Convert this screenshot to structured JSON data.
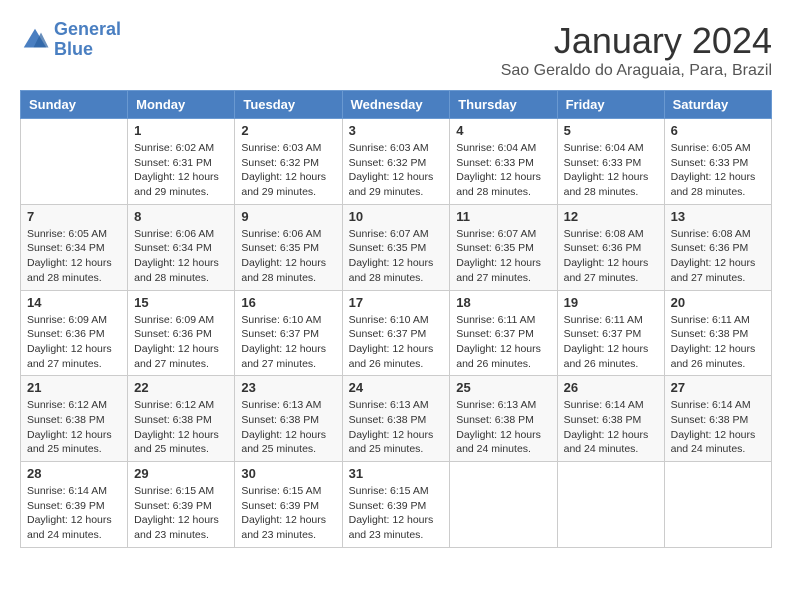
{
  "header": {
    "logo_line1": "General",
    "logo_line2": "Blue",
    "month": "January 2024",
    "location": "Sao Geraldo do Araguaia, Para, Brazil"
  },
  "weekdays": [
    "Sunday",
    "Monday",
    "Tuesday",
    "Wednesday",
    "Thursday",
    "Friday",
    "Saturday"
  ],
  "weeks": [
    [
      {
        "num": "",
        "info": ""
      },
      {
        "num": "1",
        "info": "Sunrise: 6:02 AM\nSunset: 6:31 PM\nDaylight: 12 hours\nand 29 minutes."
      },
      {
        "num": "2",
        "info": "Sunrise: 6:03 AM\nSunset: 6:32 PM\nDaylight: 12 hours\nand 29 minutes."
      },
      {
        "num": "3",
        "info": "Sunrise: 6:03 AM\nSunset: 6:32 PM\nDaylight: 12 hours\nand 29 minutes."
      },
      {
        "num": "4",
        "info": "Sunrise: 6:04 AM\nSunset: 6:33 PM\nDaylight: 12 hours\nand 28 minutes."
      },
      {
        "num": "5",
        "info": "Sunrise: 6:04 AM\nSunset: 6:33 PM\nDaylight: 12 hours\nand 28 minutes."
      },
      {
        "num": "6",
        "info": "Sunrise: 6:05 AM\nSunset: 6:33 PM\nDaylight: 12 hours\nand 28 minutes."
      }
    ],
    [
      {
        "num": "7",
        "info": "Sunrise: 6:05 AM\nSunset: 6:34 PM\nDaylight: 12 hours\nand 28 minutes."
      },
      {
        "num": "8",
        "info": "Sunrise: 6:06 AM\nSunset: 6:34 PM\nDaylight: 12 hours\nand 28 minutes."
      },
      {
        "num": "9",
        "info": "Sunrise: 6:06 AM\nSunset: 6:35 PM\nDaylight: 12 hours\nand 28 minutes."
      },
      {
        "num": "10",
        "info": "Sunrise: 6:07 AM\nSunset: 6:35 PM\nDaylight: 12 hours\nand 28 minutes."
      },
      {
        "num": "11",
        "info": "Sunrise: 6:07 AM\nSunset: 6:35 PM\nDaylight: 12 hours\nand 27 minutes."
      },
      {
        "num": "12",
        "info": "Sunrise: 6:08 AM\nSunset: 6:36 PM\nDaylight: 12 hours\nand 27 minutes."
      },
      {
        "num": "13",
        "info": "Sunrise: 6:08 AM\nSunset: 6:36 PM\nDaylight: 12 hours\nand 27 minutes."
      }
    ],
    [
      {
        "num": "14",
        "info": "Sunrise: 6:09 AM\nSunset: 6:36 PM\nDaylight: 12 hours\nand 27 minutes."
      },
      {
        "num": "15",
        "info": "Sunrise: 6:09 AM\nSunset: 6:36 PM\nDaylight: 12 hours\nand 27 minutes."
      },
      {
        "num": "16",
        "info": "Sunrise: 6:10 AM\nSunset: 6:37 PM\nDaylight: 12 hours\nand 27 minutes."
      },
      {
        "num": "17",
        "info": "Sunrise: 6:10 AM\nSunset: 6:37 PM\nDaylight: 12 hours\nand 26 minutes."
      },
      {
        "num": "18",
        "info": "Sunrise: 6:11 AM\nSunset: 6:37 PM\nDaylight: 12 hours\nand 26 minutes."
      },
      {
        "num": "19",
        "info": "Sunrise: 6:11 AM\nSunset: 6:37 PM\nDaylight: 12 hours\nand 26 minutes."
      },
      {
        "num": "20",
        "info": "Sunrise: 6:11 AM\nSunset: 6:38 PM\nDaylight: 12 hours\nand 26 minutes."
      }
    ],
    [
      {
        "num": "21",
        "info": "Sunrise: 6:12 AM\nSunset: 6:38 PM\nDaylight: 12 hours\nand 25 minutes."
      },
      {
        "num": "22",
        "info": "Sunrise: 6:12 AM\nSunset: 6:38 PM\nDaylight: 12 hours\nand 25 minutes."
      },
      {
        "num": "23",
        "info": "Sunrise: 6:13 AM\nSunset: 6:38 PM\nDaylight: 12 hours\nand 25 minutes."
      },
      {
        "num": "24",
        "info": "Sunrise: 6:13 AM\nSunset: 6:38 PM\nDaylight: 12 hours\nand 25 minutes."
      },
      {
        "num": "25",
        "info": "Sunrise: 6:13 AM\nSunset: 6:38 PM\nDaylight: 12 hours\nand 24 minutes."
      },
      {
        "num": "26",
        "info": "Sunrise: 6:14 AM\nSunset: 6:38 PM\nDaylight: 12 hours\nand 24 minutes."
      },
      {
        "num": "27",
        "info": "Sunrise: 6:14 AM\nSunset: 6:38 PM\nDaylight: 12 hours\nand 24 minutes."
      }
    ],
    [
      {
        "num": "28",
        "info": "Sunrise: 6:14 AM\nSunset: 6:39 PM\nDaylight: 12 hours\nand 24 minutes."
      },
      {
        "num": "29",
        "info": "Sunrise: 6:15 AM\nSunset: 6:39 PM\nDaylight: 12 hours\nand 23 minutes."
      },
      {
        "num": "30",
        "info": "Sunrise: 6:15 AM\nSunset: 6:39 PM\nDaylight: 12 hours\nand 23 minutes."
      },
      {
        "num": "31",
        "info": "Sunrise: 6:15 AM\nSunset: 6:39 PM\nDaylight: 12 hours\nand 23 minutes."
      },
      {
        "num": "",
        "info": ""
      },
      {
        "num": "",
        "info": ""
      },
      {
        "num": "",
        "info": ""
      }
    ]
  ]
}
